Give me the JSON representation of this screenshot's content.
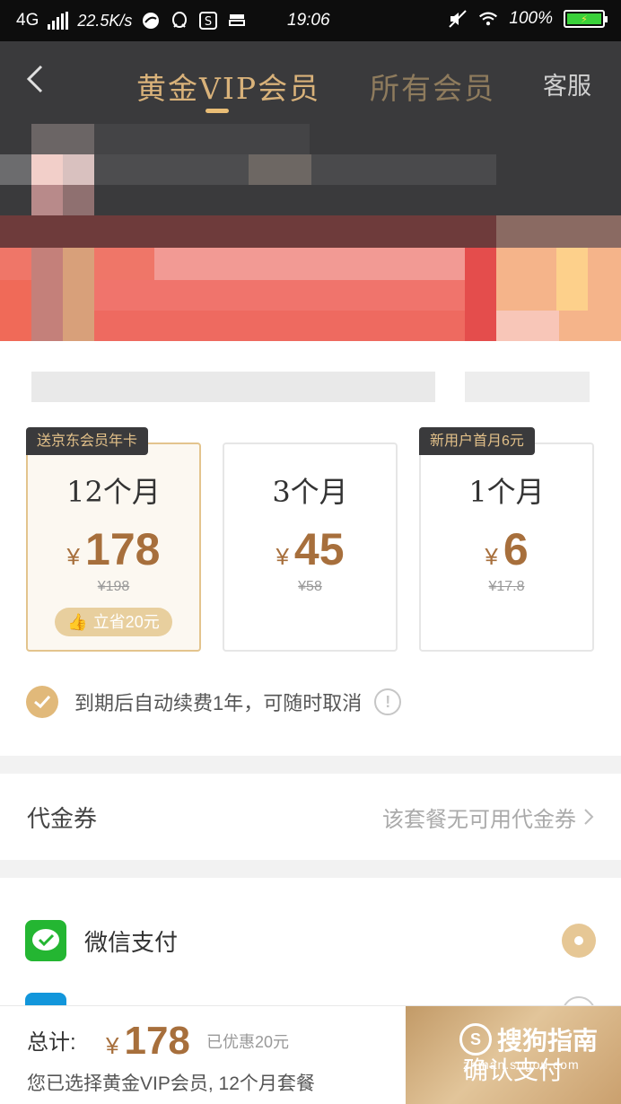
{
  "status_bar": {
    "network": "4G",
    "speed": "22.5K/s",
    "time": "19:06",
    "battery": "100%"
  },
  "header": {
    "tab_active": "黄金VIP会员",
    "tab_inactive": "所有会员",
    "service": "客服"
  },
  "plans": [
    {
      "badge": "送京东会员年卡",
      "duration": "12个月",
      "price": "178",
      "original": "¥198",
      "save": "立省20元"
    },
    {
      "badge": "",
      "duration": "3个月",
      "price": "45",
      "original": "¥58",
      "save": ""
    },
    {
      "badge": "新用户首月6元",
      "duration": "1个月",
      "price": "6",
      "original": "¥17.8",
      "save": ""
    }
  ],
  "currency": "¥",
  "renew_note": "到期后自动续费1年，可随时取消",
  "voucher": {
    "label": "代金券",
    "value": "该套餐无可用代金券"
  },
  "payment": {
    "wechat": "微信支付"
  },
  "bottom": {
    "total_label": "总计:",
    "total_price": "178",
    "discount": "已优惠20元",
    "summary": "您已选择黄金VIP会员, 12个月套餐",
    "confirm": "确认支付"
  },
  "watermark": {
    "brand": "搜狗指南",
    "url": "zhinan.sogou.com"
  },
  "colors": {
    "gold": "#d9b27a",
    "price": "#a76f3c",
    "dark": "#3a3a3c",
    "wechat_green": "#24b632"
  }
}
